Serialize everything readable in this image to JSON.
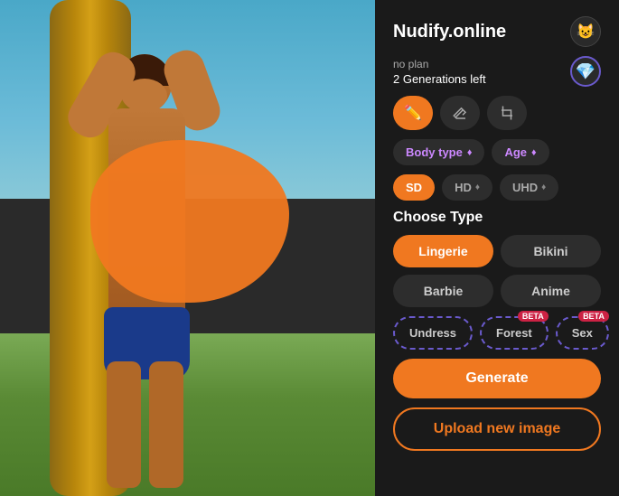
{
  "app": {
    "title": "Nudify.online",
    "header_icon": "😺"
  },
  "plan": {
    "name": "no plan",
    "generations": "2 Generations left",
    "gem_icon": "💎"
  },
  "tools": {
    "brush_icon": "✏️",
    "eraser_icon": "◻",
    "crop_icon": "⊡"
  },
  "options": {
    "body_type_label": "Body type",
    "age_label": "Age",
    "diamond": "♦"
  },
  "quality": {
    "sd_label": "SD",
    "hd_label": "HD",
    "uhd_label": "UHD",
    "diamond": "♦"
  },
  "choose_type": {
    "title": "Choose Type",
    "types": [
      {
        "label": "Lingerie",
        "active": true,
        "id": "lingerie"
      },
      {
        "label": "Bikini",
        "active": false,
        "id": "bikini"
      },
      {
        "label": "Barbie",
        "active": false,
        "id": "barbie"
      },
      {
        "label": "Anime",
        "active": false,
        "id": "anime"
      }
    ],
    "beta_types": [
      {
        "label": "Undress",
        "beta": false,
        "id": "undress"
      },
      {
        "label": "Forest",
        "beta": true,
        "id": "forest"
      },
      {
        "label": "Sex",
        "beta": true,
        "id": "sex"
      }
    ]
  },
  "actions": {
    "generate_label": "Generate",
    "upload_label": "Upload new image"
  }
}
